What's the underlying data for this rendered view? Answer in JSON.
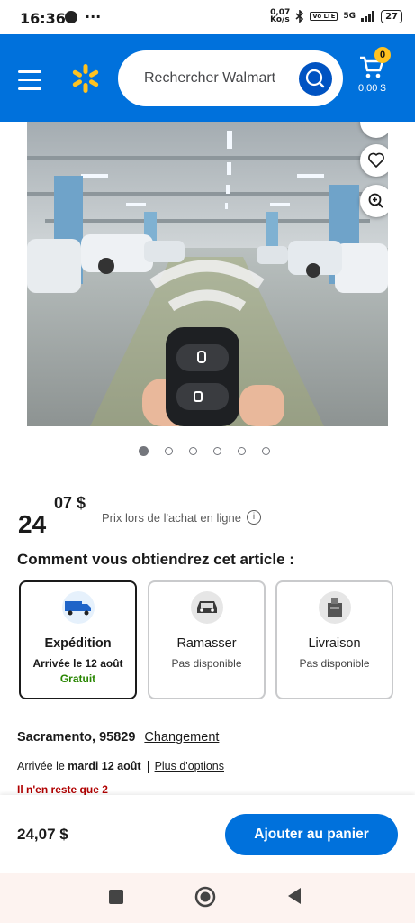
{
  "status_bar": {
    "time": "16:36",
    "overflow": "···",
    "net_speed": "0,07\nKo/s",
    "network": "5G",
    "battery": "27"
  },
  "header": {
    "search_placeholder": "Rechercher Walmart",
    "cart_count": "0",
    "cart_total": "0,00 $",
    "accent_color": "#0071dc",
    "spark_color": "#ffc220"
  },
  "gallery": {
    "image_count": 6,
    "active_index": 0
  },
  "price": {
    "dollars": "24",
    "cents": "07 $",
    "note": "Prix lors de l'achat en ligne",
    "info_icon": "i"
  },
  "fulfillment": {
    "title": "Comment vous obtiendrez cet article :",
    "options": [
      {
        "name": "Expédition",
        "sub": "Arrivée le 12 août",
        "extra": "Gratuit",
        "icon": "shipping-truck-icon",
        "selected": true
      },
      {
        "name": "Ramasser",
        "sub": "Pas disponible",
        "icon": "pickup-car-icon",
        "selected": false
      },
      {
        "name": "Livraison",
        "sub": "Pas disponible",
        "icon": "delivery-bag-icon",
        "selected": false
      }
    ]
  },
  "location": {
    "place": "Sacramento, 95829",
    "change_label": "Changement",
    "arrival_prefix": "Arrivée le",
    "arrival_date": "mardi 12 août",
    "more_options": "Plus d'options",
    "stock_warning": "Il n'en reste que 2"
  },
  "bottom_bar": {
    "price": "24,07 $",
    "add_to_cart": "Ajouter au panier"
  }
}
